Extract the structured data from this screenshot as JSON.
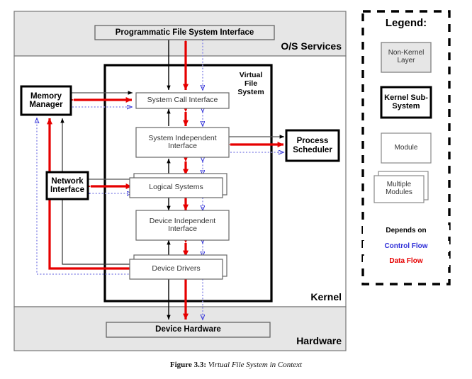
{
  "figure": {
    "caption_prefix": "Figure 3.3:",
    "caption_title": "Virtual File System in Context"
  },
  "diagram": {
    "layers": [
      {
        "id": "os-services",
        "label": "O/S Services",
        "fill": "#e6e6e6"
      },
      {
        "id": "kernel",
        "label": "Kernel",
        "fill": "#ffffff"
      },
      {
        "id": "hardware",
        "label": "Hardware",
        "fill": "#e6e6e6"
      }
    ],
    "subsystem_container": {
      "id": "virtual-file-system",
      "label_lines": [
        "Virtual",
        "File",
        "System"
      ]
    },
    "boxes": [
      {
        "id": "programmatic-file-system-interface",
        "label": "Programmatic File System Interface",
        "kind": "layer-box"
      },
      {
        "id": "memory-manager",
        "label": "Memory\nManager",
        "lines": [
          "Memory",
          "Manager"
        ],
        "kind": "kernel-subsystem"
      },
      {
        "id": "network-interface",
        "label": "Network\nInterface",
        "lines": [
          "Network",
          "Interface"
        ],
        "kind": "kernel-subsystem"
      },
      {
        "id": "process-scheduler",
        "label": "Process\nScheduler",
        "lines": [
          "Process",
          "Scheduler"
        ],
        "kind": "kernel-subsystem"
      },
      {
        "id": "system-call-interface",
        "label": "System Call Interface",
        "kind": "module"
      },
      {
        "id": "system-independent-interface",
        "label": "System Independent\nInterface",
        "lines": [
          "System Independent",
          "Interface"
        ],
        "kind": "module"
      },
      {
        "id": "logical-systems",
        "label": "Logical Systems",
        "kind": "multiple-modules"
      },
      {
        "id": "device-independent-interface",
        "label": "Device Independent\nInterface",
        "lines": [
          "Device Independent",
          "Interface"
        ],
        "kind": "module"
      },
      {
        "id": "device-drivers",
        "label": "Device Drivers",
        "kind": "multiple-modules"
      },
      {
        "id": "device-hardware",
        "label": "Device Hardware",
        "kind": "layer-box"
      }
    ]
  },
  "legend": {
    "title": "Legend:",
    "items": [
      {
        "id": "non-kernel-layer",
        "lines": [
          "Non-Kernel",
          "Layer"
        ],
        "style": "shaded-box"
      },
      {
        "id": "kernel-sub-system",
        "lines": [
          "Kernel Sub-",
          "System"
        ],
        "style": "bold-box"
      },
      {
        "id": "module",
        "lines": [
          "Module"
        ],
        "style": "thin-box"
      },
      {
        "id": "multiple-modules",
        "lines": [
          "Multiple",
          "Modules"
        ],
        "style": "stacked-box"
      }
    ],
    "keys": [
      {
        "id": "depends-on",
        "label": "Depends on",
        "color": "#000000",
        "style": "solid"
      },
      {
        "id": "control-flow",
        "label": "Control Flow",
        "color": "#2f2fd8",
        "style": "dotted"
      },
      {
        "id": "data-flow",
        "label": "Data Flow",
        "color": "#e60000",
        "style": "solid-thick"
      }
    ]
  },
  "colors": {
    "shade": "#e6e6e6",
    "depends_on": "#000000",
    "control_flow": "#2f2fd8",
    "control_flow_light": "#8f8fe8",
    "data_flow": "#e60000",
    "box_border": "#666666",
    "bold_border": "#000000"
  }
}
